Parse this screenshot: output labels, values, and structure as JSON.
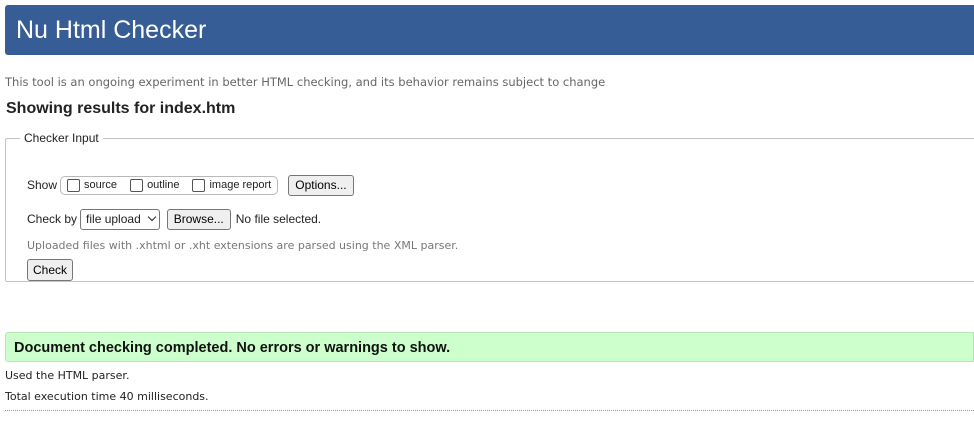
{
  "header": {
    "title": "Nu Html Checker",
    "background_color": "#365d95"
  },
  "intro": "This tool is an ongoing experiment in better HTML checking, and its behavior remains subject to change",
  "results_title": "Showing results for index.htm",
  "checker_input": {
    "legend": "Checker Input",
    "show_label": "Show",
    "show_options": [
      {
        "label": "source",
        "checked": false
      },
      {
        "label": "outline",
        "checked": false
      },
      {
        "label": "image report",
        "checked": false
      }
    ],
    "options_button": "Options...",
    "check_by_label": "Check by",
    "check_by_selected": "file upload",
    "browse_button": "Browse...",
    "file_status": "No file selected.",
    "note": "Uploaded files with .xhtml or .xht extensions are parsed using the XML parser.",
    "check_button": "Check"
  },
  "result": {
    "message": "Document checking completed. No errors or warnings to show.",
    "background_color": "#ccffcc"
  },
  "meta": {
    "parser": "Used the HTML parser.",
    "execution_time": "Total execution time 40 milliseconds."
  }
}
